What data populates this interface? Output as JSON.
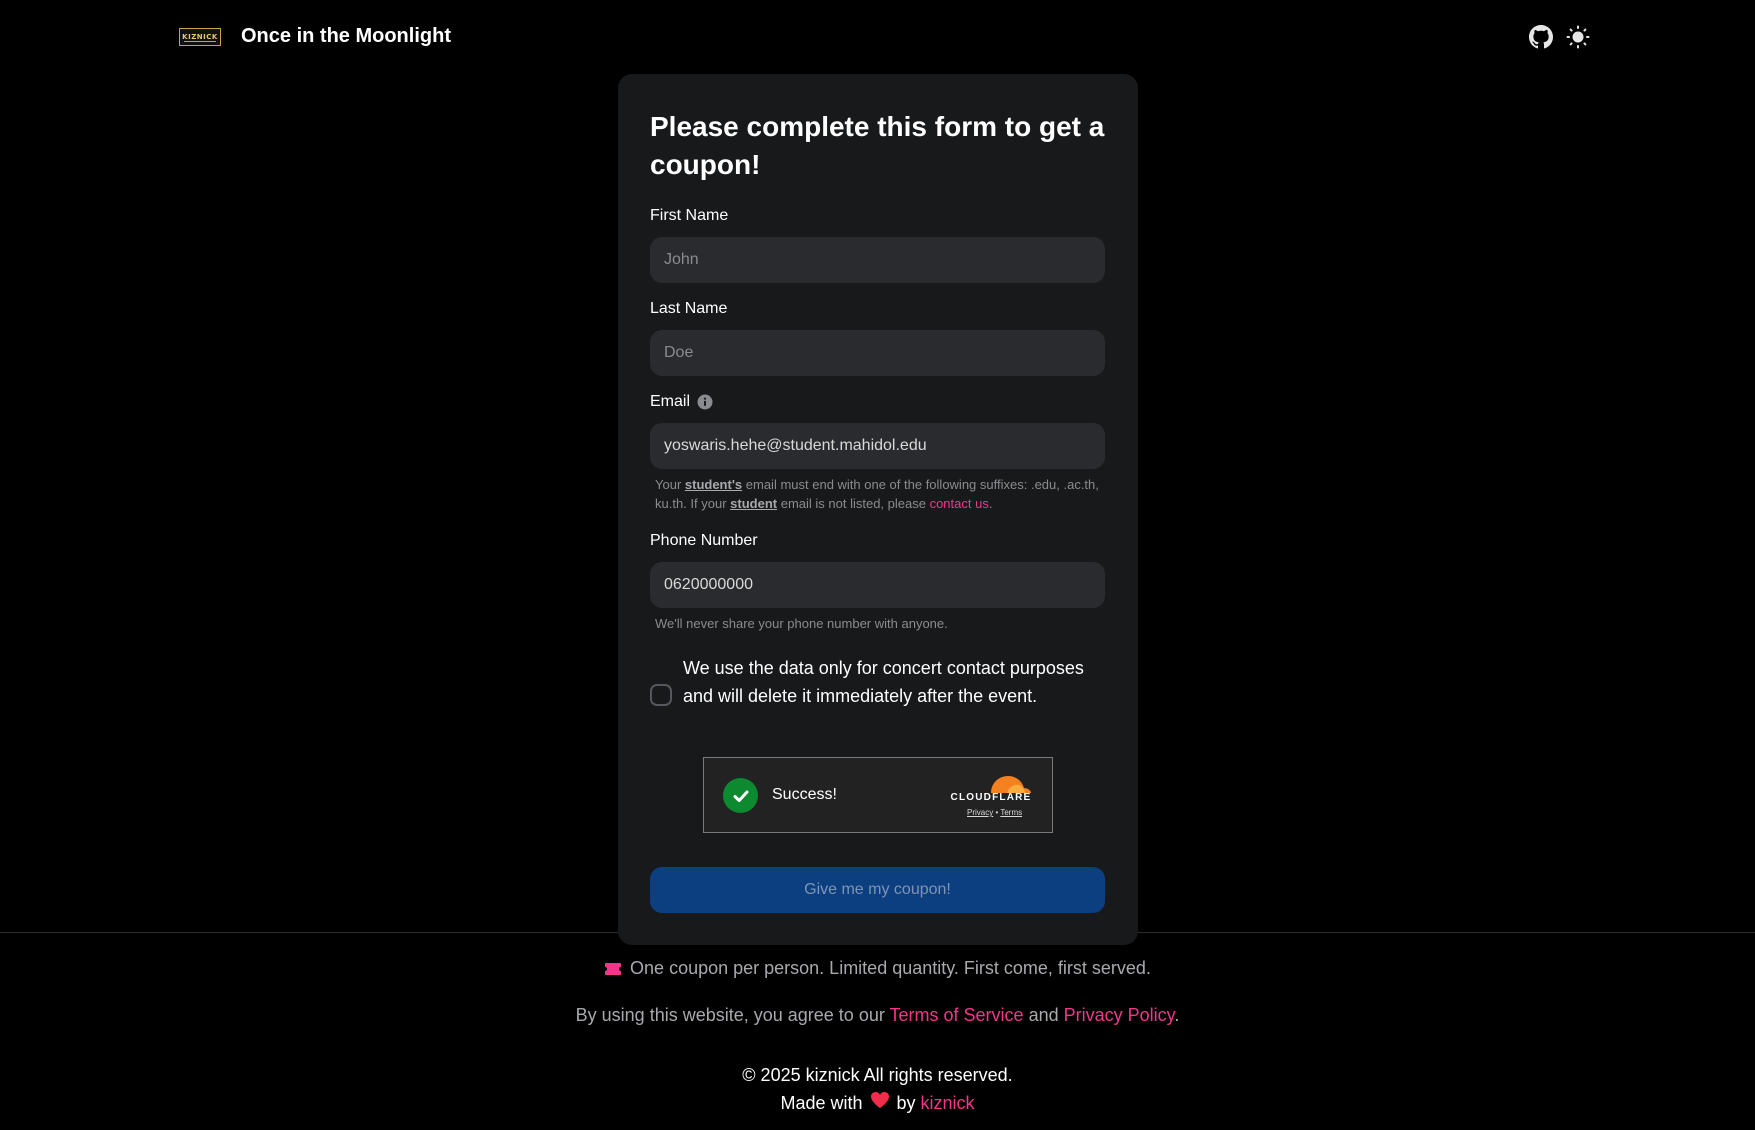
{
  "header": {
    "logo_text": "KIZNICK",
    "site_title": "Once in the Moonlight",
    "icons": [
      "github-icon",
      "sun-icon"
    ]
  },
  "form": {
    "title": "Please complete this form to get a coupon!",
    "first_name": {
      "label": "First Name",
      "placeholder": "John",
      "value": ""
    },
    "last_name": {
      "label": "Last Name",
      "placeholder": "Doe",
      "value": ""
    },
    "email": {
      "label": "Email",
      "value": "yoswaris.hehe@student.mahidol.edu",
      "help": {
        "part1": "Your ",
        "link1": "student's",
        "part2": " email must end with one of the following suffixes: .edu, .ac.th, ku.th. If your ",
        "link2": "student",
        "part3": " email is not listed, please ",
        "contact": "contact us",
        "end": "."
      }
    },
    "phone": {
      "label": "Phone Number",
      "value": "0620000000",
      "help": "We'll never share your phone number with anyone."
    },
    "consent": {
      "checked": false,
      "text": "We use the data only for concert contact purposes and will delete it immediately after the event."
    },
    "captcha": {
      "status": "Success!",
      "provider": "CLOUDFLARE",
      "privacy": "Privacy",
      "separator": " • ",
      "terms": "Terms"
    },
    "submit_label": "Give me my coupon!"
  },
  "footer": {
    "coupon_note": "One coupon per person. Limited quantity. First come, first served.",
    "tos_prefix": "By using this website, you agree to our ",
    "tos_link": "Terms of Service",
    "tos_and": " and ",
    "privacy_link": "Privacy Policy",
    "tos_end": ".",
    "copyright": "© 2025 kiznick All rights reserved.",
    "made_with": "Made with",
    "by": " by ",
    "author": "kiznick"
  },
  "colors": {
    "background": "#000000",
    "card": "#18191b",
    "input": "#2a2b2e",
    "accent_pink": "#f2368a",
    "button": "#0c3f80",
    "success": "#0d8a30",
    "cloudflare_orange": "#f48120"
  }
}
